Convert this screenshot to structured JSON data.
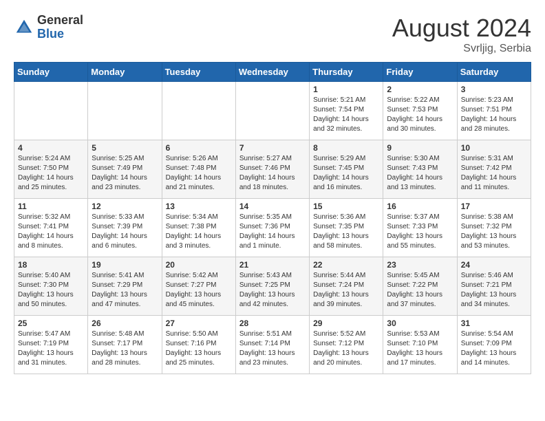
{
  "header": {
    "logo_general": "General",
    "logo_blue": "Blue",
    "month_year": "August 2024",
    "location": "Svrljig, Serbia"
  },
  "days_of_week": [
    "Sunday",
    "Monday",
    "Tuesday",
    "Wednesday",
    "Thursday",
    "Friday",
    "Saturday"
  ],
  "weeks": [
    [
      {
        "day": "",
        "info": ""
      },
      {
        "day": "",
        "info": ""
      },
      {
        "day": "",
        "info": ""
      },
      {
        "day": "",
        "info": ""
      },
      {
        "day": "1",
        "info": "Sunrise: 5:21 AM\nSunset: 7:54 PM\nDaylight: 14 hours\nand 32 minutes."
      },
      {
        "day": "2",
        "info": "Sunrise: 5:22 AM\nSunset: 7:53 PM\nDaylight: 14 hours\nand 30 minutes."
      },
      {
        "day": "3",
        "info": "Sunrise: 5:23 AM\nSunset: 7:51 PM\nDaylight: 14 hours\nand 28 minutes."
      }
    ],
    [
      {
        "day": "4",
        "info": "Sunrise: 5:24 AM\nSunset: 7:50 PM\nDaylight: 14 hours\nand 25 minutes."
      },
      {
        "day": "5",
        "info": "Sunrise: 5:25 AM\nSunset: 7:49 PM\nDaylight: 14 hours\nand 23 minutes."
      },
      {
        "day": "6",
        "info": "Sunrise: 5:26 AM\nSunset: 7:48 PM\nDaylight: 14 hours\nand 21 minutes."
      },
      {
        "day": "7",
        "info": "Sunrise: 5:27 AM\nSunset: 7:46 PM\nDaylight: 14 hours\nand 18 minutes."
      },
      {
        "day": "8",
        "info": "Sunrise: 5:29 AM\nSunset: 7:45 PM\nDaylight: 14 hours\nand 16 minutes."
      },
      {
        "day": "9",
        "info": "Sunrise: 5:30 AM\nSunset: 7:43 PM\nDaylight: 14 hours\nand 13 minutes."
      },
      {
        "day": "10",
        "info": "Sunrise: 5:31 AM\nSunset: 7:42 PM\nDaylight: 14 hours\nand 11 minutes."
      }
    ],
    [
      {
        "day": "11",
        "info": "Sunrise: 5:32 AM\nSunset: 7:41 PM\nDaylight: 14 hours\nand 8 minutes."
      },
      {
        "day": "12",
        "info": "Sunrise: 5:33 AM\nSunset: 7:39 PM\nDaylight: 14 hours\nand 6 minutes."
      },
      {
        "day": "13",
        "info": "Sunrise: 5:34 AM\nSunset: 7:38 PM\nDaylight: 14 hours\nand 3 minutes."
      },
      {
        "day": "14",
        "info": "Sunrise: 5:35 AM\nSunset: 7:36 PM\nDaylight: 14 hours\nand 1 minute."
      },
      {
        "day": "15",
        "info": "Sunrise: 5:36 AM\nSunset: 7:35 PM\nDaylight: 13 hours\nand 58 minutes."
      },
      {
        "day": "16",
        "info": "Sunrise: 5:37 AM\nSunset: 7:33 PM\nDaylight: 13 hours\nand 55 minutes."
      },
      {
        "day": "17",
        "info": "Sunrise: 5:38 AM\nSunset: 7:32 PM\nDaylight: 13 hours\nand 53 minutes."
      }
    ],
    [
      {
        "day": "18",
        "info": "Sunrise: 5:40 AM\nSunset: 7:30 PM\nDaylight: 13 hours\nand 50 minutes."
      },
      {
        "day": "19",
        "info": "Sunrise: 5:41 AM\nSunset: 7:29 PM\nDaylight: 13 hours\nand 47 minutes."
      },
      {
        "day": "20",
        "info": "Sunrise: 5:42 AM\nSunset: 7:27 PM\nDaylight: 13 hours\nand 45 minutes."
      },
      {
        "day": "21",
        "info": "Sunrise: 5:43 AM\nSunset: 7:25 PM\nDaylight: 13 hours\nand 42 minutes."
      },
      {
        "day": "22",
        "info": "Sunrise: 5:44 AM\nSunset: 7:24 PM\nDaylight: 13 hours\nand 39 minutes."
      },
      {
        "day": "23",
        "info": "Sunrise: 5:45 AM\nSunset: 7:22 PM\nDaylight: 13 hours\nand 37 minutes."
      },
      {
        "day": "24",
        "info": "Sunrise: 5:46 AM\nSunset: 7:21 PM\nDaylight: 13 hours\nand 34 minutes."
      }
    ],
    [
      {
        "day": "25",
        "info": "Sunrise: 5:47 AM\nSunset: 7:19 PM\nDaylight: 13 hours\nand 31 minutes."
      },
      {
        "day": "26",
        "info": "Sunrise: 5:48 AM\nSunset: 7:17 PM\nDaylight: 13 hours\nand 28 minutes."
      },
      {
        "day": "27",
        "info": "Sunrise: 5:50 AM\nSunset: 7:16 PM\nDaylight: 13 hours\nand 25 minutes."
      },
      {
        "day": "28",
        "info": "Sunrise: 5:51 AM\nSunset: 7:14 PM\nDaylight: 13 hours\nand 23 minutes."
      },
      {
        "day": "29",
        "info": "Sunrise: 5:52 AM\nSunset: 7:12 PM\nDaylight: 13 hours\nand 20 minutes."
      },
      {
        "day": "30",
        "info": "Sunrise: 5:53 AM\nSunset: 7:10 PM\nDaylight: 13 hours\nand 17 minutes."
      },
      {
        "day": "31",
        "info": "Sunrise: 5:54 AM\nSunset: 7:09 PM\nDaylight: 13 hours\nand 14 minutes."
      }
    ]
  ]
}
